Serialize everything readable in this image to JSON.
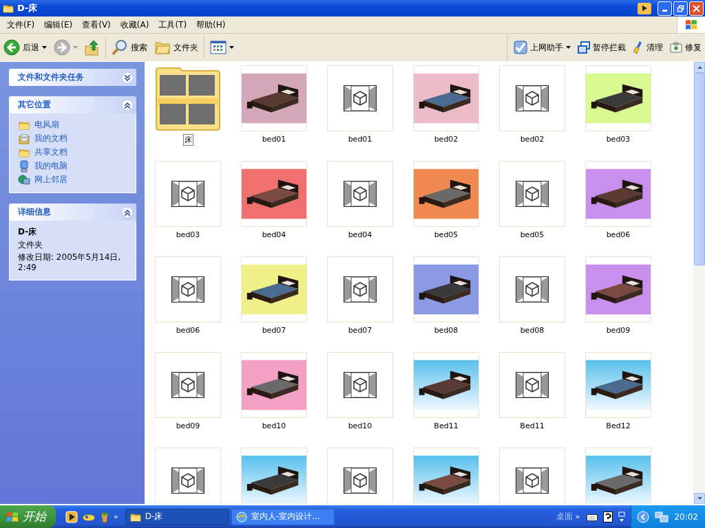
{
  "window": {
    "title": "D-床"
  },
  "menu": [
    "文件(F)",
    "编辑(E)",
    "查看(V)",
    "收藏(A)",
    "工具(T)",
    "帮助(H)"
  ],
  "toolbar": {
    "left": [
      {
        "kind": "back",
        "label": "后退"
      },
      {
        "kind": "forward"
      },
      {
        "kind": "up"
      },
      {
        "kind": "search",
        "label": "搜索"
      },
      {
        "kind": "folders",
        "label": "文件夹"
      },
      {
        "kind": "views"
      }
    ],
    "right": [
      {
        "kind": "helper",
        "label": "上网助手"
      },
      {
        "kind": "block",
        "label": "暂停拦截"
      },
      {
        "kind": "clean",
        "label": "清理"
      },
      {
        "kind": "repair",
        "label": "修复"
      }
    ]
  },
  "sidebar": [
    {
      "kind": "tasks",
      "title": "文件和文件夹任务",
      "expanded": false
    },
    {
      "kind": "places",
      "title": "其它位置",
      "expanded": true,
      "items": [
        {
          "label": "电风扇"
        },
        {
          "label": "我的文档"
        },
        {
          "label": "共享文档"
        },
        {
          "label": "我的电脑"
        },
        {
          "label": "网上邻居"
        }
      ]
    },
    {
      "kind": "details",
      "title": "详细信息",
      "expanded": true,
      "name": "D-床",
      "type": "文件夹",
      "modified": "修改日期: 2005年5月14日, 2:49"
    }
  ],
  "items": [
    {
      "kind": "folder",
      "label": "床",
      "focused": true
    },
    {
      "kind": "picture",
      "label": "bed01",
      "focused": false
    },
    {
      "kind": "file",
      "label": "bed01",
      "focused": false
    },
    {
      "kind": "picture",
      "label": "bed02",
      "focused": false
    },
    {
      "kind": "file",
      "label": "bed02",
      "focused": false
    },
    {
      "kind": "picture",
      "label": "bed03",
      "focused": false
    },
    {
      "kind": "file",
      "label": "bed03",
      "focused": false
    },
    {
      "kind": "picture",
      "label": "bed04",
      "focused": false
    },
    {
      "kind": "file",
      "label": "bed04",
      "focused": false
    },
    {
      "kind": "picture",
      "label": "bed05",
      "focused": false
    },
    {
      "kind": "file",
      "label": "bed05",
      "focused": false
    },
    {
      "kind": "picture",
      "label": "bed06",
      "focused": false
    },
    {
      "kind": "file",
      "label": "bed06",
      "focused": false
    },
    {
      "kind": "picture",
      "label": "bed07",
      "focused": false
    },
    {
      "kind": "file",
      "label": "bed07",
      "focused": false
    },
    {
      "kind": "picture",
      "label": "bed08",
      "focused": false
    },
    {
      "kind": "file",
      "label": "bed08",
      "focused": false
    },
    {
      "kind": "picture",
      "label": "bed09",
      "focused": false
    },
    {
      "kind": "file",
      "label": "bed09",
      "focused": false
    },
    {
      "kind": "picture",
      "label": "bed10",
      "focused": false
    },
    {
      "kind": "file",
      "label": "bed10",
      "focused": false
    },
    {
      "kind": "picture",
      "label": "Bed11",
      "focused": false
    },
    {
      "kind": "file",
      "label": "Bed11",
      "focused": false
    },
    {
      "kind": "picture",
      "label": "Bed12",
      "focused": false
    },
    {
      "kind": "file",
      "focused": false
    },
    {
      "kind": "picture",
      "focused": false
    },
    {
      "kind": "file",
      "focused": false
    },
    {
      "kind": "picture",
      "focused": false
    },
    {
      "kind": "file",
      "focused": false
    },
    {
      "kind": "picture",
      "focused": false
    }
  ],
  "taskbar": {
    "start": "开始",
    "quick_launch_more": "»",
    "tasks": [
      {
        "label": "D-床",
        "selected": true
      },
      {
        "label": "室内人-室内设计...",
        "selected": false
      }
    ],
    "desktop_toolbar": "桌面",
    "desktop_more": "»",
    "clock": "20:02"
  }
}
